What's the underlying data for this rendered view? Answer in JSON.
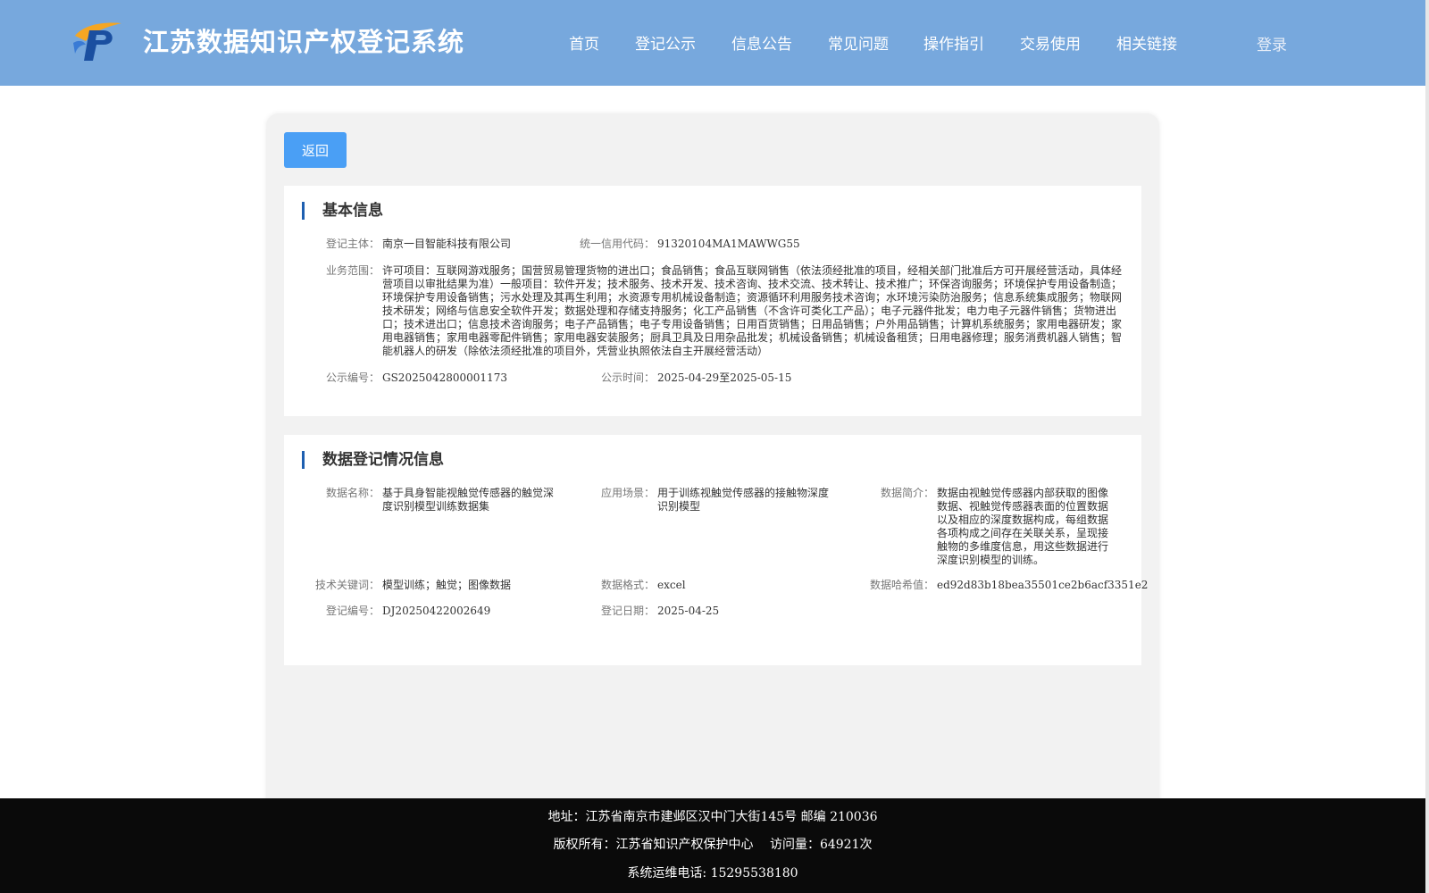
{
  "header": {
    "title": "江苏数据知识产权登记系统",
    "nav": [
      "首页",
      "登记公示",
      "信息公告",
      "常见问题",
      "操作指引",
      "交易使用",
      "相关链接"
    ],
    "login": "登录"
  },
  "back_label": "返回",
  "basic": {
    "title": "基本信息",
    "entity_label": "登记主体：",
    "entity": "南京一目智能科技有限公司",
    "credit_label": "统一信用代码：",
    "credit": "91320104MA1MAWWG55",
    "scope_label": "业务范围：",
    "scope": "许可项目：互联网游戏服务；国营贸易管理货物的进出口；食品销售；食品互联网销售（依法须经批准的项目，经相关部门批准后方可开展经营活动，具体经营项目以审批结果为准）一般项目：软件开发；技术服务、技术开发、技术咨询、技术交流、技术转让、技术推广；环保咨询服务；环境保护专用设备制造；环境保护专用设备销售；污水处理及其再生利用；水资源专用机械设备制造；资源循环利用服务技术咨询；水环境污染防治服务；信息系统集成服务；物联网技术研发；网络与信息安全软件开发；数据处理和存储支持服务；化工产品销售（不含许可类化工产品）；电子元器件批发；电力电子元器件销售；货物进出口；技术进出口；信息技术咨询服务；电子产品销售；电子专用设备销售；日用百货销售；日用品销售；户外用品销售；计算机系统服务；家用电器研发；家用电器销售；家用电器零配件销售；家用电器安装服务；厨具卫具及日用杂品批发；机械设备销售；机械设备租赁；日用电器修理；服务消费机器人销售；智能机器人的研发（除依法须经批准的项目外，凭营业执照依法自主开展经营活动）",
    "pub_no_label": "公示编号：",
    "pub_no": "GS2025042800001173",
    "pub_time_label": "公示时间：",
    "pub_time": "2025-04-29至2025-05-15"
  },
  "data_info": {
    "title": "数据登记情况信息",
    "name_label": "数据名称：",
    "name": "基于具身智能视触觉传感器的触觉深度识别模型训练数据集",
    "scene_label": "应用场景：",
    "scene": "用于训练视触觉传感器的接触物深度识别模型",
    "intro_label": "数据简介：",
    "intro": "数据由视触觉传感器内部获取的图像数据、视触觉传感器表面的位置数据以及相应的深度数据构成，每组数据各项构成之间存在关联关系，呈现接触物的多维度信息，用这些数据进行深度识别模型的训练。",
    "keywords_label": "技术关键词：",
    "keywords": "模型训练；触觉；图像数据",
    "format_label": "数据格式：",
    "format": "excel",
    "hash_label": "数据哈希值：",
    "hash": "ed92d83b18bea35501ce2b6acf3351e2",
    "reg_no_label": "登记编号：",
    "reg_no": "DJ20250422002649",
    "reg_date_label": "登记日期：",
    "reg_date": "2025-04-25"
  },
  "footer": {
    "address": "地址：江苏省南京市建邺区汉中门大街145号 邮编 210036",
    "copyright": "版权所有：江苏省知识产权保护中心　 访问量：64921次",
    "phone": "系统运维电话: 15295538180"
  }
}
